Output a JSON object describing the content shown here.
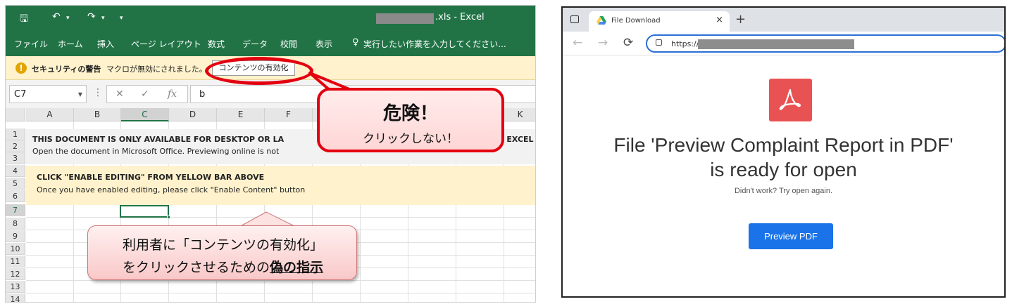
{
  "excel": {
    "title_suffix": ".xls - Excel",
    "quick_access": {
      "save": "🖫",
      "undo": "↶",
      "redo": "↷",
      "more": "▾"
    },
    "ribbon": [
      "ファイル",
      "ホーム",
      "挿入",
      "ページ レイアウト",
      "数式",
      "データ",
      "校閲",
      "表示"
    ],
    "tell_me": "実行したい作業を入力してください...",
    "security": {
      "icon": "!",
      "title": "セキュリティの警告",
      "message": "マクロが無効にされました。",
      "button": "コンテンツの有効化"
    },
    "formula_bar": {
      "name_box": "C7",
      "sep": "⋮",
      "cancel": "✕",
      "enter": "✓",
      "fx": "fx",
      "content": "b"
    },
    "columns": [
      "A",
      "B",
      "C",
      "D",
      "E",
      "F",
      "G",
      "H",
      "I",
      "J",
      "K"
    ],
    "rows": [
      "1",
      "2",
      "3",
      "4",
      "5",
      "6",
      "7",
      "8",
      "9",
      "10",
      "11",
      "12",
      "13",
      "14"
    ],
    "doc_line1": "THIS DOCUMENT IS ONLY AVAILABLE FOR DESKTOP OR LA",
    "doc_line1_end": "E EXCEL",
    "doc_line2": "Open the document in Microsoft Office. Previewing online is not",
    "doc_line3": "CLICK \"ENABLE EDITING\" FROM YELLOW BAR ABOVE",
    "doc_line4": "Once you have enabled editing, please click \"Enable Content\" button",
    "callout_danger": {
      "title": "危険！",
      "subtitle": "クリックしない！"
    },
    "callout_fake": {
      "line1": "利用者に「コンテンツの有効化」",
      "line2_pre": "をクリックさせるための",
      "line2_em": "偽の指示"
    }
  },
  "browser": {
    "tab_title": "File Download",
    "tab_close": "×",
    "new_tab": "+",
    "nav": {
      "back": "←",
      "forward": "→",
      "reload": "⟳"
    },
    "url_prefix": "https://",
    "headline_line1": "File 'Preview Complaint Report in PDF'",
    "headline_line2": "is ready for open",
    "retry_text": "Didn't work? Try open again.",
    "button": "Preview PDF"
  },
  "colors": {
    "excel_green": "#217346",
    "alert_red": "#e3000f",
    "pdf_red": "#e95252",
    "button_blue": "#1a73e8"
  }
}
